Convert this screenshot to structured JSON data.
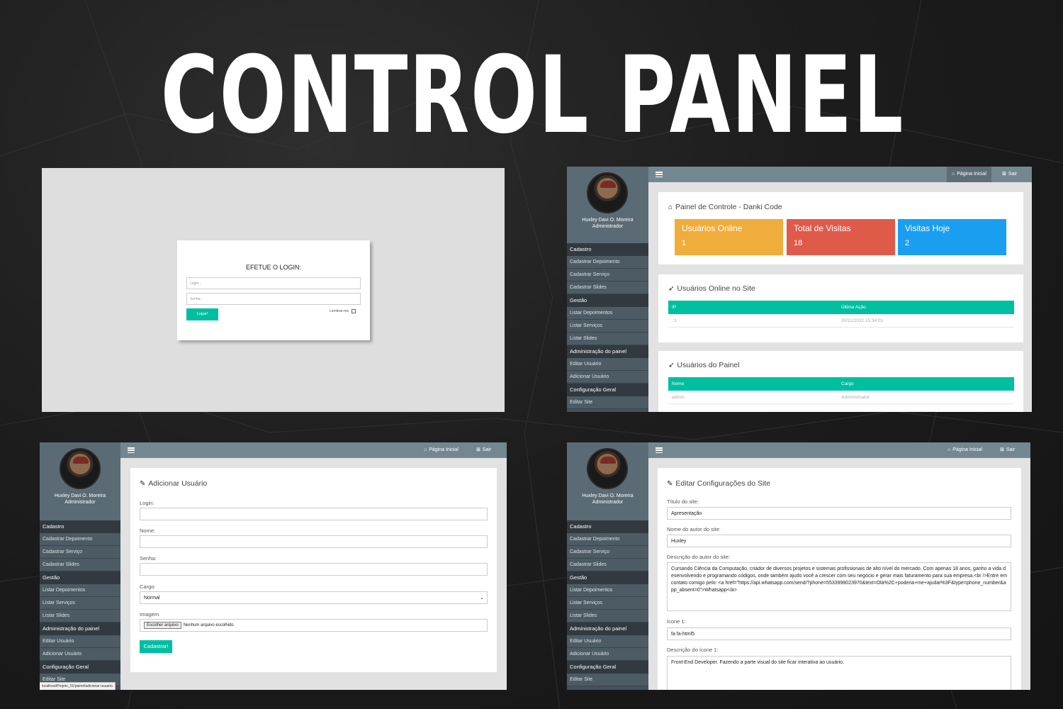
{
  "page_title": "CONTROL PANEL",
  "login": {
    "title": "EFETUE O LOGIN:",
    "login_placeholder": "Login...",
    "password_placeholder": "Senha...",
    "submit_label": "Logar!",
    "remember_label": "Lembrar-me"
  },
  "profile": {
    "name": "Huxley Davi O. Moreira",
    "role": "Administrador"
  },
  "menu": {
    "cadastro": {
      "heading": "Cadastro",
      "items": [
        "Cadastrar Depoimento",
        "Cadastrar Serviço",
        "Cadastrar Slides"
      ]
    },
    "gestao": {
      "heading": "Gestão",
      "items": [
        "Listar Depoimentos",
        "Listar Serviços",
        "Listar Slides"
      ]
    },
    "admin": {
      "heading": "Administração do painel",
      "items": [
        "Editar Usuário",
        "Adicionar Usuário"
      ]
    },
    "config": {
      "heading": "Configuração Geral",
      "items": [
        "Editar Site"
      ]
    }
  },
  "topbar": {
    "home_label": "Página Inicial",
    "logout_label": "Sair"
  },
  "dashboard": {
    "title": "Painel de Controle - Danki Code",
    "stats": [
      {
        "label": "Usuários Online",
        "value": "1",
        "color": "#f0ad3c"
      },
      {
        "label": "Total de Visitas",
        "value": "18",
        "color": "#e05a4a"
      },
      {
        "label": "Visitas Hoje",
        "value": "2",
        "color": "#1a9ff0"
      }
    ],
    "online": {
      "title": "Usuários Online no Site",
      "columns": [
        "IP",
        "Última Ação"
      ],
      "rows": [
        [
          "::1",
          "30/11/2022 15:34:01"
        ]
      ]
    },
    "panel_users": {
      "title": "Usuários do Painel",
      "columns": [
        "Nome",
        "Cargo"
      ],
      "rows": [
        [
          "admin",
          "Administrador"
        ]
      ]
    }
  },
  "add_user": {
    "title": "Adicionar Usuário",
    "login_label": "Login:",
    "name_label": "Nome:",
    "password_label": "Senha:",
    "role_label": "Cargo:",
    "role_value": "Normal",
    "image_label": "Imagem",
    "file_button": "Escolher arquivo",
    "file_status": "Nenhum arquivo escolhido",
    "submit_label": "Cadastrar!",
    "status_url": "localhost/Projeto_01/painel/adicionar-usuario"
  },
  "edit_site": {
    "title": "Editar Configurações do Site",
    "site_title_label": "Título do site:",
    "site_title_value": "Apresentação",
    "author_label": "Nome do autor do site:",
    "author_value": "Huxley",
    "author_desc_label": "Descrição do autor do site:",
    "author_desc_value": "Cursando Ciência da Computação, criador de diversos projetos e sistemas profissionais de alto nível do mercado. Com apenas 18 anos, ganho a vida desenvolvendo e programando códigos, onde também ajudo você a crescer com seu negócio e gerar mais faturamento para sua empresa.<br />Entre em contato comigo pelo: <a href=\"https://api.whatsapp.com/send/?phone=5533998023970&text=Olá%2C+poderia+me+ajudar%3F&type=phone_number&app_absent=0\">Whatsapp</a>",
    "icon1_label": "Ícone 1:",
    "icon1_value": "fa fa-html5",
    "icon1_desc_label": "Descrição do ícone 1:",
    "icon1_desc_value": "Front-End Developer. Fazendo a parte visual do site ficar interativa ao usuário."
  },
  "colors": {
    "accent": "#00bfa0",
    "sidebar": "#44525b",
    "topbar": "#738791"
  }
}
